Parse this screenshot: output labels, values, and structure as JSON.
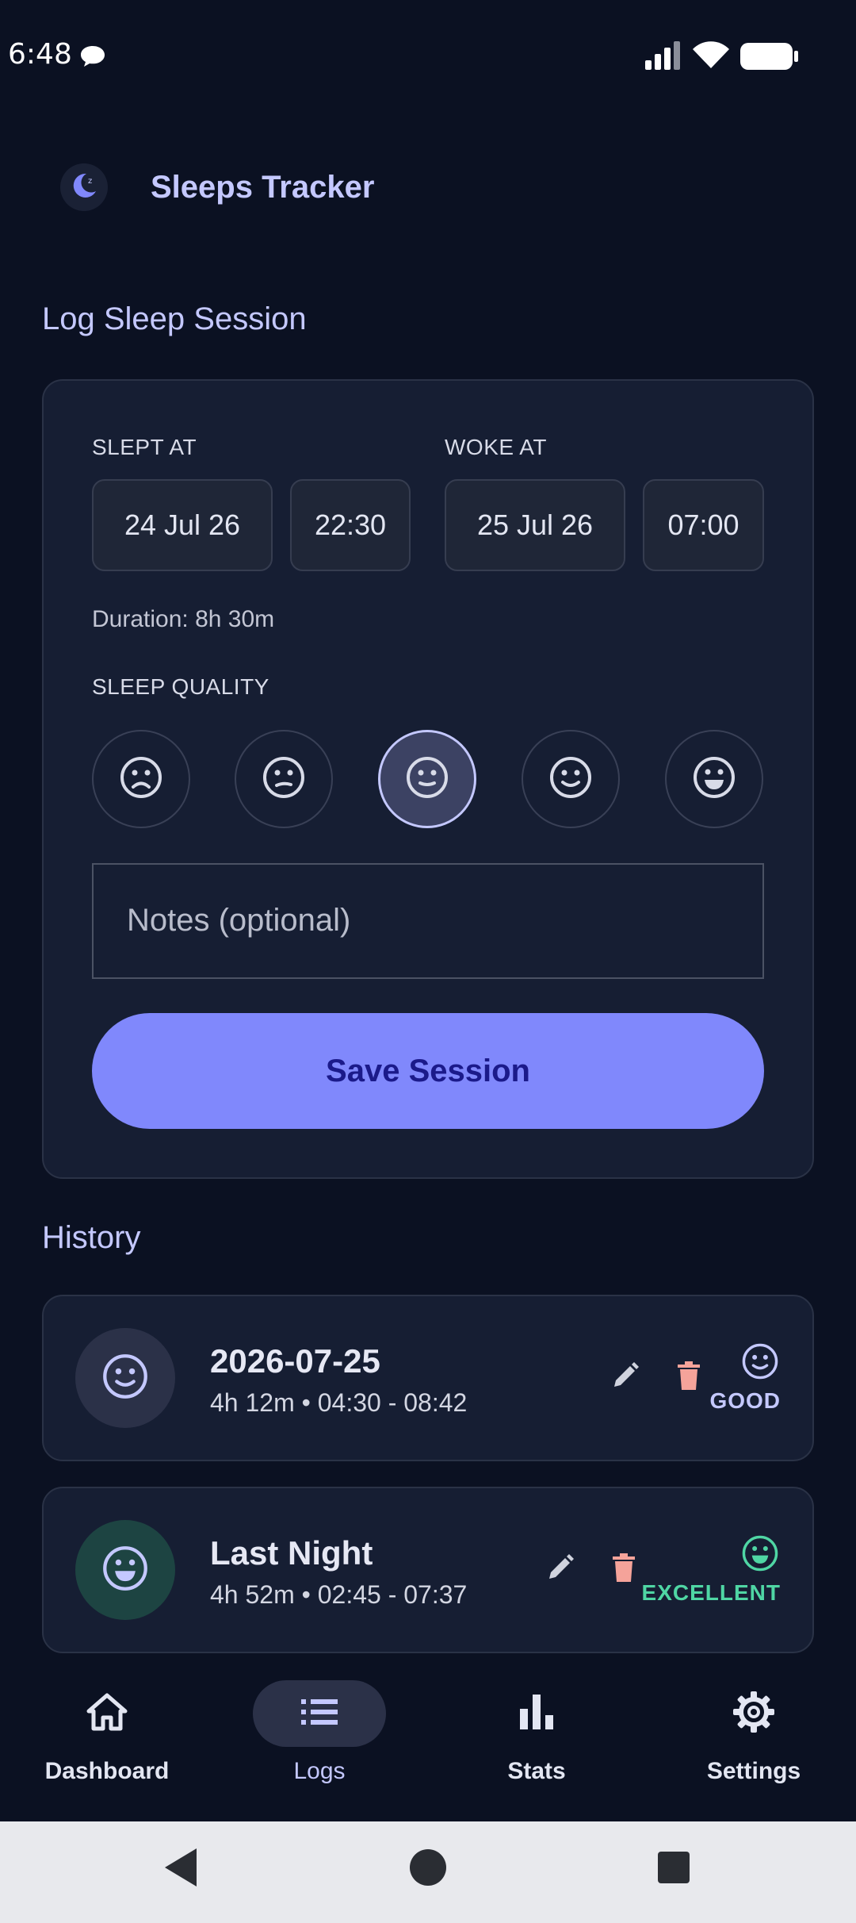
{
  "status_bar": {
    "time": "6:48"
  },
  "app": {
    "title": "Sleeps Tracker",
    "logo_icon": "moon-icon"
  },
  "log_section": {
    "title": "Log Sleep Session"
  },
  "form": {
    "slept_at_label": "SLEPT AT",
    "slept_date": "24 Jul 26",
    "slept_time": "22:30",
    "woke_at_label": "WOKE AT",
    "woke_date": "25 Jul 26",
    "woke_time": "07:00",
    "duration": "Duration: 8h 30m",
    "quality_label": "SLEEP QUALITY",
    "quality_options": [
      "very-bad-face-icon",
      "bad-face-icon",
      "neutral-face-icon",
      "good-face-icon",
      "excellent-face-icon"
    ],
    "quality_selected_index": 2,
    "notes_placeholder": "Notes (optional)",
    "save_label": "Save Session"
  },
  "history": {
    "title": "History",
    "entries": [
      {
        "title": "2026-07-25",
        "subtitle": "4h 12m • 04:30 - 08:42",
        "quality": "GOOD",
        "quality_color": "#c4c8ff",
        "avatar_bg": "#2b3148"
      },
      {
        "title": "Last Night",
        "subtitle": "4h 52m • 02:45 - 07:37",
        "quality": "EXCELLENT",
        "quality_color": "#4fd6a4",
        "avatar_bg": "#1d4442"
      }
    ]
  },
  "bottom_nav": {
    "items": [
      {
        "label": "Dashboard",
        "icon": "home-icon"
      },
      {
        "label": "Logs",
        "icon": "list-icon",
        "active": true
      },
      {
        "label": "Stats",
        "icon": "bar-chart-icon"
      },
      {
        "label": "Settings",
        "icon": "gear-icon"
      }
    ]
  },
  "colors": {
    "background": "#0b1122",
    "accent": "#8088fc",
    "accent_text": "#c4c8ff",
    "delete": "#f5a39a"
  }
}
